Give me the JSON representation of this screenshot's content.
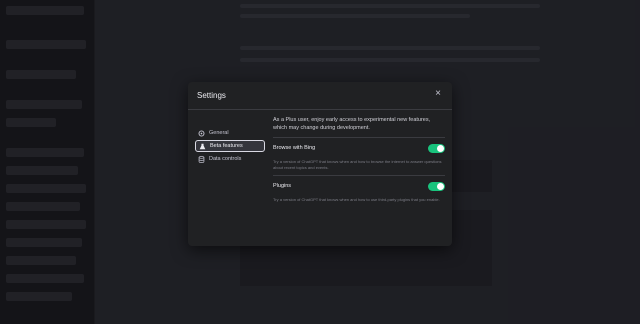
{
  "modal": {
    "title": "Settings",
    "close_glyph": "×"
  },
  "nav": {
    "items": [
      {
        "label": "General",
        "icon": "gear-icon",
        "active": false
      },
      {
        "label": "Beta features",
        "icon": "flask-icon",
        "active": true
      },
      {
        "label": "Data controls",
        "icon": "database-icon",
        "active": false
      }
    ]
  },
  "content": {
    "intro": "As a Plus user, enjoy early access to experimental new features, which may change during development.",
    "features": [
      {
        "title": "Browse with Bing",
        "description": "Try a version of ChatGPT that knows when and how to browse the internet to answer questions about recent topics and events.",
        "enabled": true
      },
      {
        "title": "Plugins",
        "description": "Try a version of ChatGPT that knows when and how to use third-party plugins that you enable.",
        "enabled": true
      }
    ]
  },
  "colors": {
    "toggle_on": "#19c37d",
    "modal_bg": "#202123",
    "backdrop": "#2f3038"
  }
}
